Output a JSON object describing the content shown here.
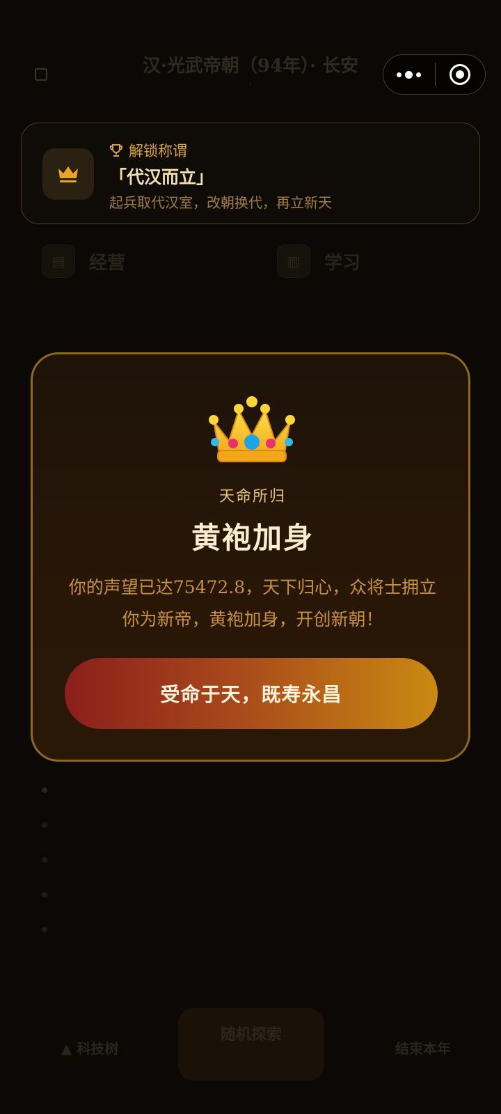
{
  "background": {
    "header": {
      "title": "汉·光武帝朝（94年）· 长安",
      "subtitle": "·"
    },
    "actions": [
      {
        "label": "经营",
        "icon": "shop-icon"
      },
      {
        "label": "学习",
        "icon": "book-icon"
      }
    ],
    "bottom_bar": {
      "left_label": "▲ 科技树",
      "explore_label": "随机探索",
      "explore_sub": "·",
      "right_label": "结束本年"
    }
  },
  "capsule": {
    "more_icon": "more-icon",
    "close_icon": "close-target-icon"
  },
  "toast": {
    "header_label": "解锁称谓",
    "title_name": "「代汉而立」",
    "description": "起兵取代汉室，改朝换代，再立新天",
    "icon": "crown-icon",
    "accent_color": "#d9a33a"
  },
  "modal": {
    "emoji": "crown-emoji",
    "kicker": "天命所归",
    "title": "黄袍加身",
    "body_line1": "你的声望已达75472.8，天下归心，众将士拥立",
    "body_line2": "你为新帝，黄袍加身，开创新朝！",
    "button_label": "受命于天，既寿永昌",
    "border_color": "#8e6a1f"
  }
}
